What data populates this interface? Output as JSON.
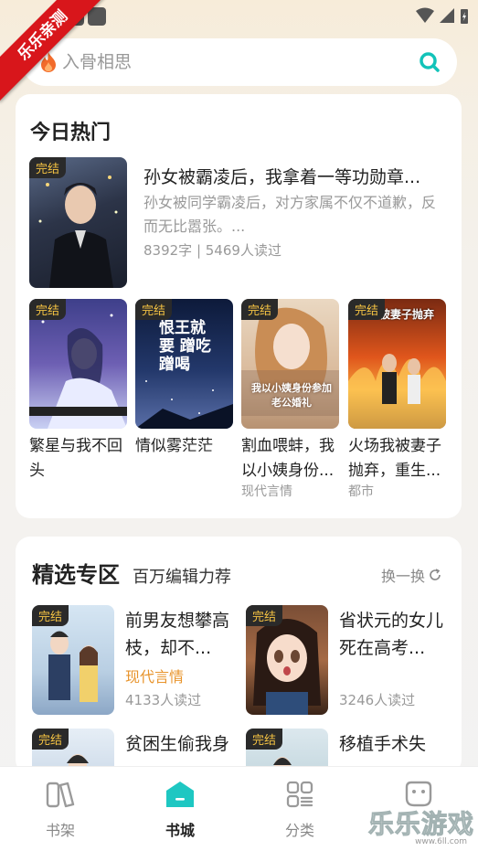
{
  "watermark": {
    "corner_ribbon": "乐乐亲测",
    "brand": "乐乐游戏",
    "url": "www.6ll.com"
  },
  "search": {
    "placeholder": "入骨相思",
    "icons": [
      "flame-icon",
      "search-icon"
    ]
  },
  "hot": {
    "title": "今日热门",
    "featured": {
      "badge": "完结",
      "title": "孙女被霸凌后，我拿着一等功勋章...",
      "desc": "孙女被同学霸凌后，对方家属不仅不道歉，反而无比嚣张。...",
      "meta": "8392字 | 5469人读过"
    },
    "books": [
      {
        "badge": "完结",
        "title": "繁星与我不回头",
        "tag": ""
      },
      {
        "badge": "完结",
        "title": "情似雾茫茫",
        "tag": ""
      },
      {
        "badge": "完结",
        "title": "割血喂蚌，我以小姨身份...",
        "tag": "现代言情"
      },
      {
        "badge": "完结",
        "title": "火场我被妻子抛弃，重生...",
        "tag": "都市"
      }
    ],
    "cover_texts": {
      "b2": "恨王就要 蹭吃蹭喝",
      "b3": "我以小姨身份参加老公婚礼",
      "b4": "被妻子抛弃"
    }
  },
  "selected": {
    "title": "精选专区",
    "subtitle": "百万编辑力荐",
    "swap_label": "换一换",
    "books": [
      {
        "badge": "完结",
        "title": "前男友想攀高枝，却不...",
        "tag": "现代言情",
        "meta": "4133人读过"
      },
      {
        "badge": "完结",
        "title": "省状元的女儿死在高考...",
        "tag": "",
        "meta": "3246人读过"
      },
      {
        "badge": "完结",
        "title": "贫困生偷我身份，偷了...",
        "tag": "",
        "meta": ""
      },
      {
        "badge": "完结",
        "title": "移植手术失败，我假死...",
        "tag": "",
        "meta": ""
      }
    ]
  },
  "tabs": [
    {
      "label": "书架",
      "icon": "bookshelf-icon",
      "active": false
    },
    {
      "label": "书城",
      "icon": "bookstore-icon",
      "active": true
    },
    {
      "label": "分类",
      "icon": "category-icon",
      "active": false
    },
    {
      "label": "",
      "icon": "profile-icon",
      "active": false
    }
  ],
  "colors": {
    "accent": "#1ec7c2",
    "badge_text": "#f5c343",
    "tag": "#e8942c"
  }
}
